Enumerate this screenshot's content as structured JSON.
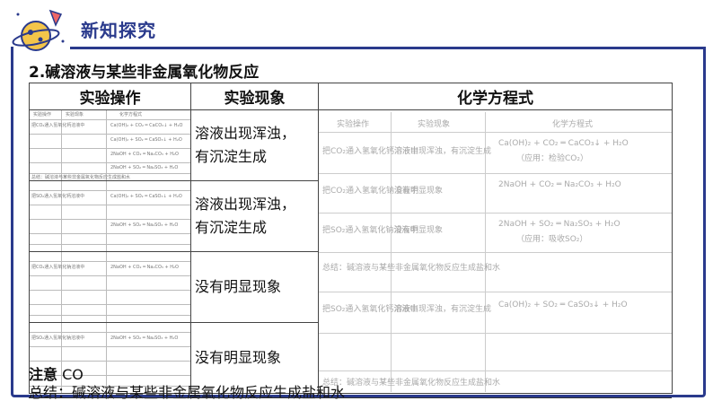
{
  "header": {
    "title": "新知探究"
  },
  "section": {
    "title": "2.碱溶液与某些非金属氧化物反应"
  },
  "table": {
    "headers": [
      "实验操作",
      "实验现象",
      "化学方程式"
    ],
    "observations": [
      [
        "溶液出现浑浊，",
        "有沉淀生成"
      ],
      [
        "溶液出现浑浊，",
        "有沉淀生成"
      ],
      [
        "没有明显现象"
      ],
      [
        "没有明显现象"
      ]
    ],
    "thumb": {
      "headers": [
        "实验操作",
        "实验现象",
        "化学方程式"
      ],
      "ops": [
        "把CO₂通入氢氧化钙溶液中",
        "把SO₂通入氢氧化钙溶液中",
        "把CO₂通入氢氧化钠溶液中",
        "把SO₂通入氢氧化钠溶液中"
      ],
      "obs": [
        "溶液出现浑浊，有沉淀生成",
        "溶液出现浑浊，有沉淀生成",
        "没有明显现象",
        "没有明显现象"
      ],
      "eqs": [
        "Ca(OH)₂ + CO₂ ═ CaCO₃↓ + H₂O",
        "Ca(OH)₂ + SO₂ ═ CaSO₃↓ + H₂O",
        "2NaOH + CO₂ ═ Na₂CO₃ + H₂O",
        "2NaOH + SO₂ ═ Na₂SO₃ + H₂O"
      ],
      "uses": [
        "（应用：检验CO₂）",
        "（应用：吸收SO₂）"
      ],
      "summary": "总结：碱溶液与某些非金属氧化物反应生成盐和水"
    }
  },
  "note": {
    "label": "注意",
    "text": "CO"
  },
  "summary": {
    "text": "总结：碱溶液与某些非金属氧化物反应生成盐和水"
  }
}
